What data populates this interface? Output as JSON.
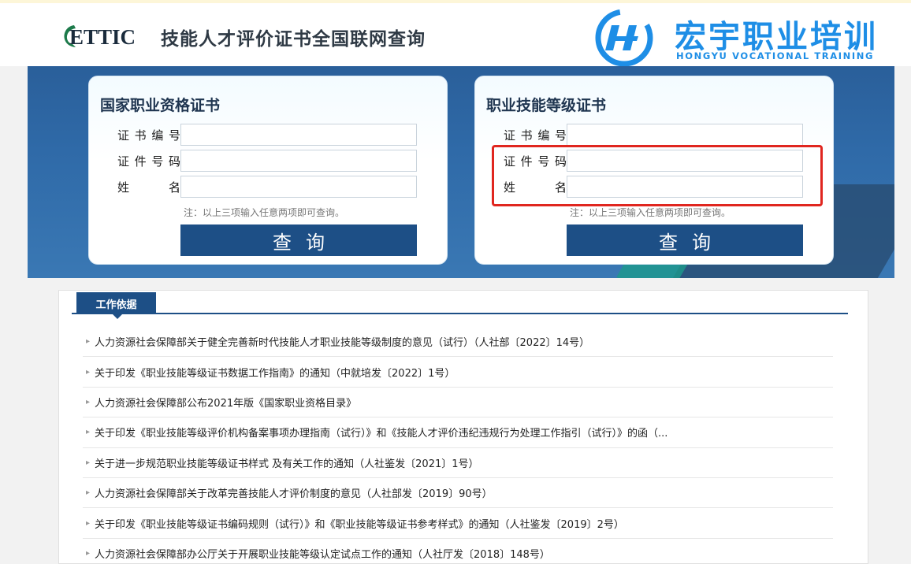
{
  "header": {
    "logo_text": "ETTIC",
    "title": "技能人才评价证书全国联网查询",
    "brand_name": "宏宇职业培训",
    "brand_sub": "HONGYU VOCATIONAL TRAINING"
  },
  "left_card": {
    "title": "国家职业资格证书",
    "fields": [
      {
        "label": "证书编号",
        "value": ""
      },
      {
        "label": "证件号码",
        "value": ""
      },
      {
        "label": "姓　名",
        "value": ""
      }
    ],
    "note": "注：以上三项输入任意两项即可查询。",
    "button": "查询"
  },
  "right_card": {
    "title": "职业技能等级证书",
    "fields": [
      {
        "label": "证书编号",
        "value": ""
      },
      {
        "label": "证件号码",
        "value": ""
      },
      {
        "label": "姓　名",
        "value": ""
      }
    ],
    "note": "注：以上三项输入任意两项即可查询。",
    "button": "查询"
  },
  "colors": {
    "primary": "#1d4f86",
    "highlight": "#e0261f",
    "brand": "#1e8ee6"
  },
  "section": {
    "tab": "工作依据",
    "items": [
      "人力资源社会保障部关于健全完善新时代技能人才职业技能等级制度的意见（试行）（人社部〔2022〕14号）",
      "关于印发《职业技能等级证书数据工作指南》的通知（中就培发〔2022〕1号）",
      "人力资源社会保障部公布2021年版《国家职业资格目录》",
      "关于印发《职业技能等级评价机构备案事项办理指南（试行）》和《技能人才评价违纪违规行为处理工作指引（试行）》的函（...",
      "关于进一步规范职业技能等级证书样式 及有关工作的通知（人社鉴发〔2021〕1号）",
      "人力资源社会保障部关于改革完善技能人才评价制度的意见（人社部发〔2019〕90号）",
      "关于印发《职业技能等级证书编码规则（试行）》和《职业技能等级证书参考样式》的通知（人社鉴发〔2019〕2号）",
      "人力资源社会保障部办公厅关于开展职业技能等级认定试点工作的通知（人社厅发〔2018〕148号）"
    ]
  }
}
